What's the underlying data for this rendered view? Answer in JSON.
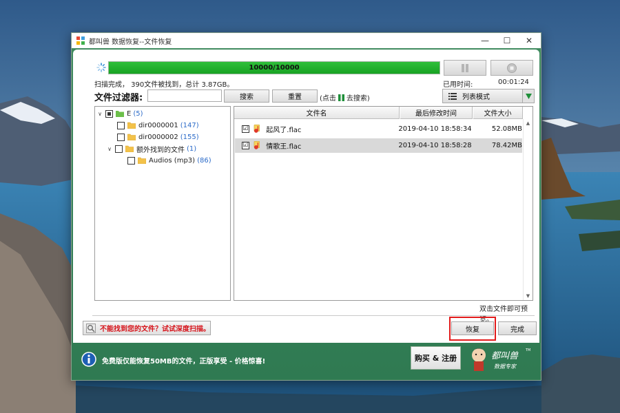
{
  "window": {
    "title": "都叫兽 数据恢复--文件恢复",
    "minimize_icon": "—",
    "maximize_icon": "☐",
    "close_icon": "✕"
  },
  "progress": {
    "text": "10000/10000",
    "fraction": 1.0
  },
  "status": {
    "scan_summary": "扫描完成，  390文件被找到，总计 3.87GB。",
    "elapsed_label": "已用时间:",
    "elapsed_value": "00:01:24"
  },
  "filter": {
    "label": "文件过滤器:",
    "input_value": "",
    "search_label": "搜索",
    "reset_label": "重置",
    "hint_before": "(点击",
    "hint_after": "去搜索)"
  },
  "view_mode": {
    "label": "列表模式"
  },
  "tree": [
    {
      "label": "E",
      "count": "(5)",
      "expanded": true,
      "state": "partial"
    },
    {
      "label": "dir0000001",
      "count": "(147)"
    },
    {
      "label": "dir0000002",
      "count": "(155)"
    },
    {
      "label": "额外找到的文件",
      "count": "(1)",
      "expanded": true
    },
    {
      "label": "Audios (mp3)",
      "count": "(86)"
    }
  ],
  "file_list": {
    "columns": [
      "文件名",
      "最后修改时间",
      "文件大小"
    ],
    "rows": [
      {
        "name": "起风了.flac",
        "date": "2019-04-10 18:58:34",
        "size": "52.08MB",
        "checked": "☑"
      },
      {
        "name": "情歌王.flac",
        "date": "2019-04-10 18:58:28",
        "size": "78.42MB",
        "checked": "☑"
      }
    ]
  },
  "preview_hint": "双击文件即可预览。",
  "deep_scan_label": "不能找到您的文件？试试深度扫描。",
  "actions": {
    "recover_label": "恢复",
    "finish_label": "完成"
  },
  "promo": {
    "text": "免费版仅能恢复50MB的文件，正版享受 - 价格惊喜!",
    "buy_label": "购买 & 注册"
  },
  "logo": {
    "text_main": "都叫兽",
    "text_sub": "数据专家",
    "tm": "TM"
  },
  "colors": {
    "brand_green": "#2f7a52",
    "progress_green": "#1fae2b",
    "highlight_red": "#e21a1a",
    "deep_scan_red": "#d6131a",
    "count_blue": "#2a6ac8"
  }
}
